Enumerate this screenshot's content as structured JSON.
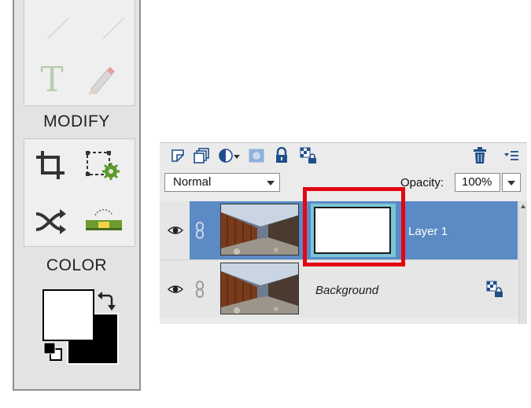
{
  "toolbox": {
    "draw_tools": [
      {
        "icon": "horizontal-type-icon",
        "label": "T"
      },
      {
        "icon": "pencil-icon"
      }
    ],
    "modify_heading": "MODIFY",
    "modify_tools": [
      {
        "icon": "crop-icon"
      },
      {
        "icon": "recompose-icon"
      },
      {
        "icon": "content-aware-move-icon"
      },
      {
        "icon": "straighten-icon"
      }
    ],
    "color_heading": "COLOR",
    "foreground_color": "#ffffff",
    "background_color": "#000000"
  },
  "layers_panel": {
    "toolbar_icons": [
      "new-layer-icon",
      "new-group-icon",
      "adjustment-layer-icon",
      "layer-mask-icon",
      "lock-all-icon",
      "lock-transparency-icon",
      "delete-layer-icon",
      "panel-menu-icon"
    ],
    "blend_mode": "Normal",
    "opacity_label": "Opacity:",
    "opacity_value": "100%",
    "layers": [
      {
        "name": "Layer 1",
        "selected": true,
        "has_mask": true
      },
      {
        "name": "Background",
        "selected": false,
        "locked": true
      }
    ],
    "selected_color": "#5b8ac4",
    "highlight_color": "#e30613"
  }
}
